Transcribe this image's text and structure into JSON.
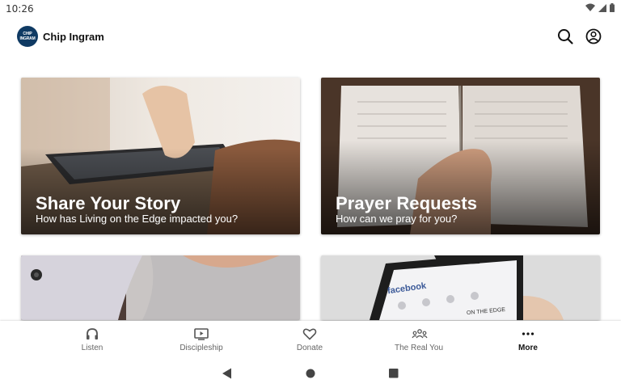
{
  "status_bar": {
    "time": "10:26"
  },
  "app_bar": {
    "logo_text": "CHIP INGRAM",
    "title": "Chip Ingram"
  },
  "cards": [
    {
      "title": "Share Your Story",
      "subtitle": "How has Living on the Edge impacted you?"
    },
    {
      "title": "Prayer Requests",
      "subtitle": "How can we pray for you?"
    },
    {
      "title": "",
      "subtitle": ""
    },
    {
      "title": "",
      "subtitle": ""
    }
  ],
  "phone_screen": {
    "brand": "facebook",
    "caption": "ON THE EDGE"
  },
  "bottom_nav": {
    "items": [
      {
        "label": "Listen",
        "icon": "headphones-icon",
        "active": false
      },
      {
        "label": "Discipleship",
        "icon": "video-player-icon",
        "active": false
      },
      {
        "label": "Donate",
        "icon": "heart-icon",
        "active": false
      },
      {
        "label": "The Real You",
        "icon": "group-icon",
        "active": false
      },
      {
        "label": "More",
        "icon": "more-dots-icon",
        "active": true
      }
    ]
  },
  "colors": {
    "brand_navy": "#0f3a63",
    "active_label": "#111111",
    "inactive_label": "#666666"
  }
}
